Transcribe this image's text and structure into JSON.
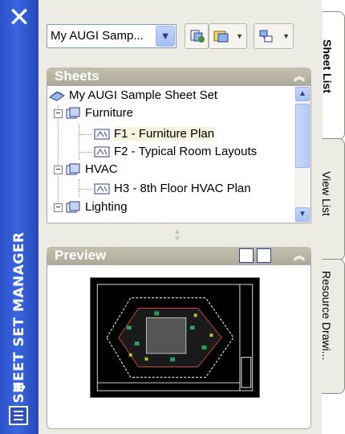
{
  "window": {
    "title": "SHEET SET MANAGER",
    "close_symbol": "✕",
    "autohide_symbol": "⇹",
    "properties_icon": "properties-icon"
  },
  "toolbar": {
    "sheet_set_value": "My AUGI Samp...",
    "buttons": [
      {
        "name": "publish",
        "icon": "publish-icon"
      },
      {
        "name": "sheet-set-manager",
        "icon": "sheetset-icon"
      },
      {
        "name": "model-view",
        "icon": "model-view-icon"
      }
    ]
  },
  "sheets": {
    "title": "Sheets",
    "root": "My AUGI Sample Sheet Set",
    "items": [
      {
        "label": "Furniture",
        "level": 1,
        "type": "subset"
      },
      {
        "label": "F1 - Furniture Plan",
        "level": 2,
        "type": "sheet",
        "selected": true
      },
      {
        "label": "F2 - Typical Room Layouts",
        "level": 2,
        "type": "sheet"
      },
      {
        "label": "HVAC",
        "level": 1,
        "type": "subset"
      },
      {
        "label": "H3 - 8th Floor HVAC Plan",
        "level": 2,
        "type": "sheet"
      },
      {
        "label": "Lighting",
        "level": 1,
        "type": "subset"
      }
    ]
  },
  "preview": {
    "title": "Preview"
  },
  "tabs": [
    {
      "label": "Sheet List",
      "active": true
    },
    {
      "label": "View List",
      "active": false
    },
    {
      "label": "Resource Drawi...",
      "active": false
    }
  ],
  "colors": {
    "titlebar": "#2a50c8",
    "panel_header": "#b4b1a0",
    "panel_bg": "#ecebe4",
    "selection": "#f4f3de"
  }
}
